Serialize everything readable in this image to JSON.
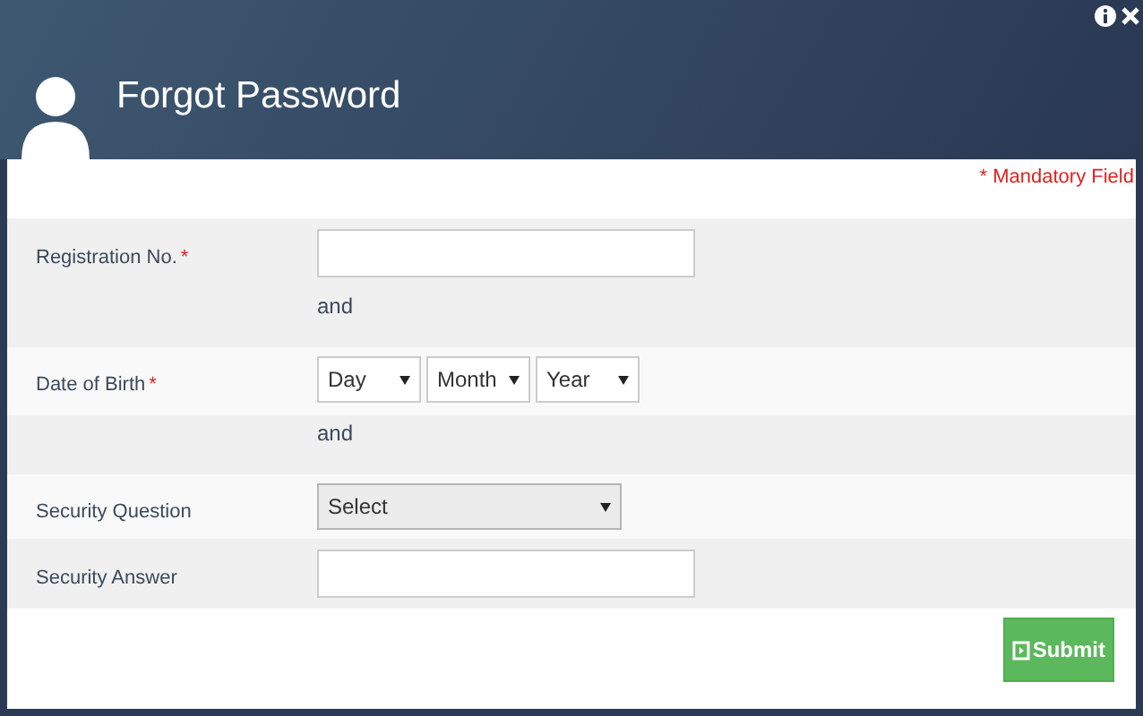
{
  "header": {
    "title": "Forgot Password"
  },
  "mandatory_note": "* Mandatory Field",
  "rows": [
    {
      "kind": "text",
      "label": "Registration No.",
      "required_mark": "*"
    },
    {
      "kind": "separator",
      "label": "and"
    },
    {
      "kind": "dates",
      "label": "Date of Birth",
      "required_mark": "*",
      "options": [
        "Day",
        "Month",
        "Year"
      ]
    },
    {
      "kind": "separator",
      "label": "and"
    },
    {
      "kind": "select",
      "label": "Security Question",
      "value": "Select"
    },
    {
      "kind": "text",
      "label": "Security Answer"
    }
  ],
  "submit": {
    "label": "Submit"
  }
}
